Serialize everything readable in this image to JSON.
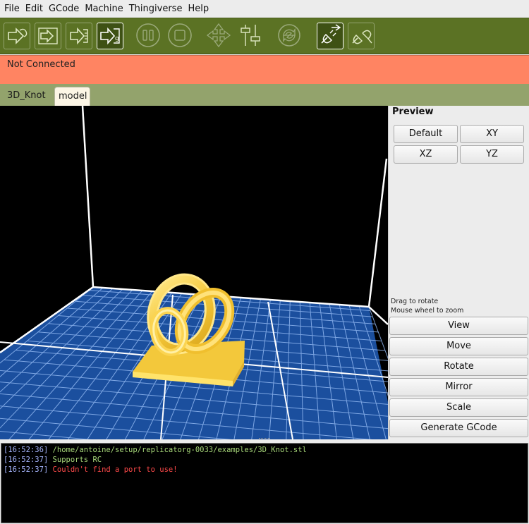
{
  "menu": [
    "File",
    "Edit",
    "GCode",
    "Machine",
    "Thingiverse",
    "Help"
  ],
  "toolbar": {
    "buttons": [
      {
        "name": "build-icon"
      },
      {
        "name": "build-to-file-icon"
      },
      {
        "name": "upload-to-sd-icon"
      },
      {
        "name": "generate-gcode-icon"
      },
      {
        "name": "pause-icon"
      },
      {
        "name": "stop-icon"
      },
      {
        "name": "jog-control-icon"
      },
      {
        "name": "control-panel-icon"
      },
      {
        "name": "reset-icon"
      },
      {
        "name": "connect-icon"
      },
      {
        "name": "disconnect-icon"
      }
    ]
  },
  "status": {
    "text": "Not Connected",
    "color": "#ff8462"
  },
  "tabs": [
    {
      "label": "3D_Knot"
    },
    {
      "label": "model"
    }
  ],
  "preview": {
    "title": "Preview",
    "buttons": [
      "Default",
      "XY",
      "XZ",
      "YZ"
    ],
    "hint_rotate": "Drag to rotate",
    "hint_zoom": "Mouse wheel to zoom"
  },
  "actions": [
    "View",
    "Move",
    "Rotate",
    "Mirror",
    "Scale",
    "Generate GCode"
  ],
  "console": [
    {
      "time": "[16:52:36]",
      "message": "/home/antoine/setup/replicatorg-0033/examples/3D_Knot.stl",
      "type": "ok"
    },
    {
      "time": "[16:52:37]",
      "message": "Supports RC",
      "type": "ok"
    },
    {
      "time": "[16:52:37]",
      "message": "Couldn't find a port to use!",
      "type": "error"
    }
  ],
  "colors": {
    "toolbar": "#5b7224",
    "tabbar": "#93a36c",
    "grid": "#1b4f9e",
    "model": "#f7d24a"
  }
}
